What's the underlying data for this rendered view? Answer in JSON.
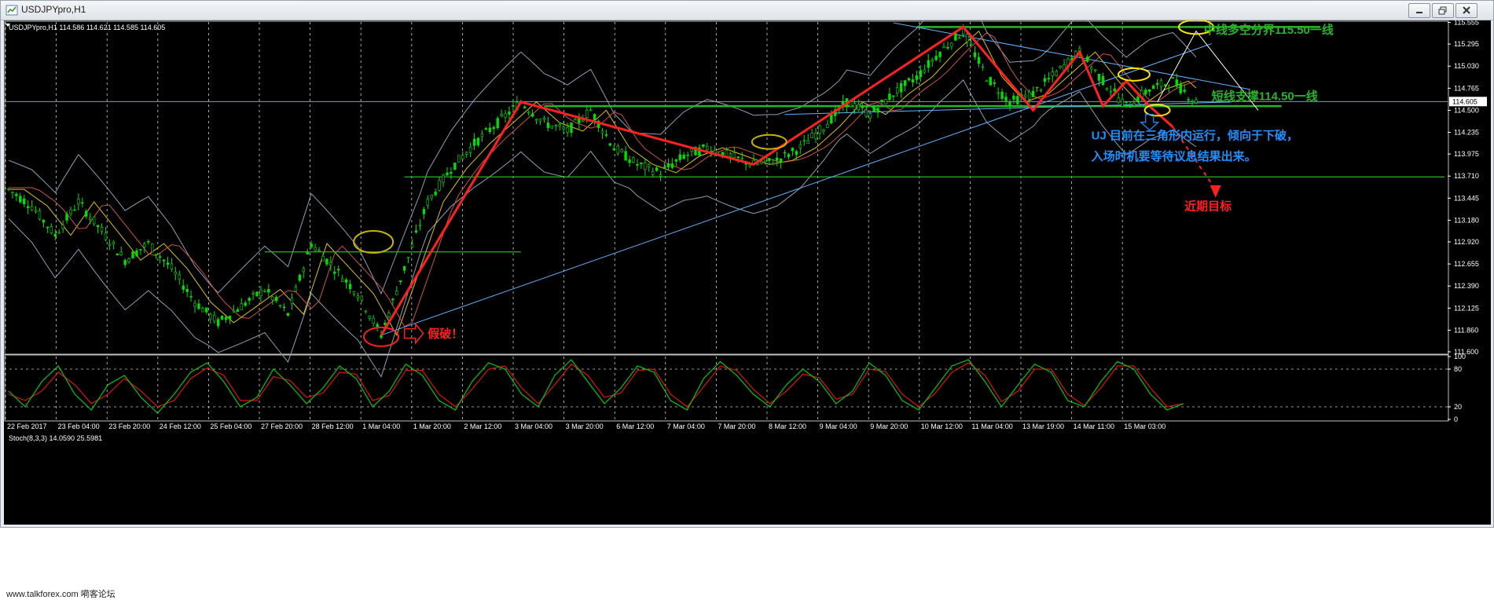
{
  "window": {
    "title": "USDJPYpro,H1"
  },
  "chart_header": "USDJPYpro,H1  114.586 114.621 114.585 114.605",
  "stoch_header": "Stoch(8,3,3) 14.0590 25.5981",
  "footer_text": "www.talkforex.com 嗬客论坛",
  "colors": {
    "background": "#000000",
    "candles": "#00e000",
    "pattern": "#ff2020",
    "levels": "#28b428",
    "trendline": "#5fb4ff",
    "bands": "#8c9fb4",
    "annotation_blue": "#1e90ff",
    "ellipse_yellow": "#ffe600",
    "stoch_main": "#00c800",
    "stoch_signal": "#e01010"
  },
  "chart_data": [
    {
      "type": "line",
      "symbol": "USDJPYpro",
      "timeframe": "H1",
      "ylim": [
        111.6,
        115.56
      ],
      "price_ticks": [
        "115.555",
        "115.295",
        "115.030",
        "114.765",
        "114.500",
        "114.235",
        "113.975",
        "113.710",
        "113.445",
        "113.180",
        "112.920",
        "112.655",
        "112.390",
        "112.125",
        "111.860",
        "111.600"
      ],
      "current_price_label": "114.605",
      "x_labels": [
        "22 Feb 2017",
        "23 Feb 04:00",
        "23 Feb 20:00",
        "24 Feb 12:00",
        "25 Feb 04:00",
        "27 Feb 20:00",
        "28 Feb 12:00",
        "1 Mar 04:00",
        "1 Mar 20:00",
        "2 Mar 12:00",
        "3 Mar 04:00",
        "3 Mar 20:00",
        "6 Mar 12:00",
        "7 Mar 04:00",
        "7 Mar 20:00",
        "8 Mar 12:00",
        "9 Mar 04:00",
        "9 Mar 20:00",
        "10 Mar 12:00",
        "11 Mar 04:00",
        "13 Mar 19:00",
        "14 Mar 11:00",
        "15 Mar 03:00"
      ],
      "price_path": [
        [
          0,
          113.55
        ],
        [
          6,
          113.35
        ],
        [
          12,
          113.0
        ],
        [
          18,
          113.4
        ],
        [
          24,
          113.05
        ],
        [
          30,
          112.7
        ],
        [
          36,
          112.9
        ],
        [
          42,
          112.6
        ],
        [
          48,
          112.2
        ],
        [
          54,
          111.95
        ],
        [
          60,
          112.15
        ],
        [
          66,
          112.35
        ],
        [
          72,
          112.05
        ],
        [
          78,
          112.9
        ],
        [
          84,
          112.6
        ],
        [
          90,
          112.3
        ],
        [
          96,
          111.8
        ],
        [
          102,
          112.6
        ],
        [
          108,
          113.4
        ],
        [
          114,
          113.8
        ],
        [
          120,
          114.1
        ],
        [
          126,
          114.35
        ],
        [
          132,
          114.6
        ],
        [
          138,
          114.35
        ],
        [
          144,
          114.25
        ],
        [
          150,
          114.5
        ],
        [
          156,
          114.05
        ],
        [
          162,
          113.85
        ],
        [
          168,
          113.75
        ],
        [
          174,
          113.95
        ],
        [
          180,
          114.05
        ],
        [
          186,
          113.95
        ],
        [
          192,
          113.85
        ],
        [
          198,
          113.9
        ],
        [
          204,
          114.05
        ],
        [
          210,
          114.3
        ],
        [
          216,
          114.6
        ],
        [
          222,
          114.45
        ],
        [
          228,
          114.7
        ],
        [
          234,
          114.9
        ],
        [
          240,
          115.2
        ],
        [
          246,
          115.45
        ],
        [
          252,
          114.9
        ],
        [
          258,
          114.6
        ],
        [
          264,
          114.7
        ],
        [
          270,
          114.95
        ],
        [
          276,
          115.2
        ],
        [
          282,
          114.85
        ],
        [
          288,
          114.55
        ],
        [
          294,
          114.75
        ],
        [
          300,
          114.85
        ],
        [
          306,
          114.6
        ]
      ],
      "zigzag": [
        [
          96,
          111.8
        ],
        [
          132,
          114.6
        ],
        [
          192,
          113.85
        ],
        [
          246,
          115.5
        ],
        [
          264,
          114.5
        ],
        [
          276,
          115.2
        ],
        [
          282,
          114.55
        ],
        [
          288,
          114.85
        ],
        [
          294,
          114.55
        ],
        [
          300,
          114.3
        ]
      ],
      "levels": [
        {
          "value": 115.5,
          "from": 234,
          "to": 338
        },
        {
          "value": 114.55,
          "from": 138,
          "to": 328
        },
        {
          "value": 113.7,
          "from": 102,
          "to": 370
        },
        {
          "value": 112.8,
          "from": 66,
          "to": 132
        }
      ],
      "annotations": [
        {
          "text": "中线多空分界115.50一线",
          "color": "#28b428"
        },
        {
          "text": "短线支撑114.50一线",
          "color": "#28b428"
        },
        {
          "text": "UJ 目前在三角形内运行，倾向于下破，",
          "color": "#1e90ff"
        },
        {
          "text": "入场时机要等待议息结果出来。",
          "color": "#1e90ff"
        },
        {
          "text": "近期目标",
          "color": "#ff2020"
        },
        {
          "text": "假破！",
          "color": "#ff2020"
        }
      ]
    },
    {
      "type": "line",
      "name": "Stoch(8,3,3)",
      "ylim": [
        0,
        100
      ],
      "ticks": [
        "100",
        "80",
        "20",
        "0"
      ],
      "levels": [
        80,
        20
      ],
      "main": [
        45,
        20,
        60,
        85,
        40,
        15,
        55,
        70,
        35,
        10,
        40,
        75,
        90,
        60,
        20,
        35,
        80,
        55,
        25,
        50,
        85,
        65,
        20,
        45,
        88,
        70,
        30,
        15,
        60,
        90,
        80,
        40,
        20,
        70,
        95,
        60,
        25,
        50,
        85,
        75,
        30,
        15,
        65,
        92,
        70,
        40,
        20,
        55,
        80,
        60,
        25,
        45,
        90,
        70,
        30,
        15,
        50,
        85,
        95,
        60,
        20,
        55,
        88,
        75,
        30,
        20,
        60,
        92,
        80,
        40,
        15,
        25
      ],
      "signal": [
        40,
        30,
        45,
        75,
        55,
        25,
        40,
        65,
        45,
        20,
        30,
        65,
        82,
        70,
        30,
        30,
        68,
        62,
        35,
        42,
        75,
        72,
        30,
        38,
        78,
        78,
        40,
        20,
        48,
        80,
        85,
        50,
        25,
        55,
        88,
        70,
        35,
        42,
        78,
        80,
        40,
        20,
        52,
        85,
        78,
        48,
        25,
        45,
        72,
        66,
        32,
        40,
        80,
        76,
        40,
        20,
        42,
        75,
        90,
        70,
        28,
        45,
        80,
        80,
        40,
        22,
        50,
        85,
        85,
        50,
        20,
        25
      ]
    }
  ]
}
